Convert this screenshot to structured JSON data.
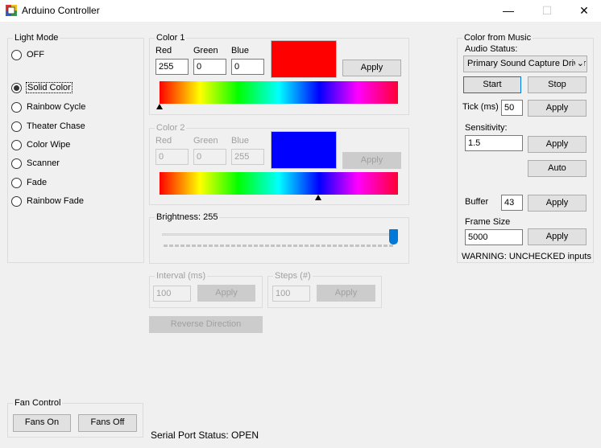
{
  "window": {
    "title": "Arduino Controller"
  },
  "light_mode": {
    "title": "Light Mode",
    "options": [
      {
        "label": "OFF",
        "checked": false
      },
      {
        "label": "Solid Color",
        "checked": true
      },
      {
        "label": "Rainbow Cycle",
        "checked": false
      },
      {
        "label": "Theater Chase",
        "checked": false
      },
      {
        "label": "Color Wipe",
        "checked": false
      },
      {
        "label": "Scanner",
        "checked": false
      },
      {
        "label": "Fade",
        "checked": false
      },
      {
        "label": "Rainbow Fade",
        "checked": false
      }
    ]
  },
  "color1": {
    "title": "Color 1",
    "red_label": "Red",
    "green_label": "Green",
    "blue_label": "Blue",
    "red": "255",
    "green": "0",
    "blue": "0",
    "swatch_color": "#ff0000",
    "apply": "Apply"
  },
  "color2": {
    "title": "Color 2",
    "red_label": "Red",
    "green_label": "Green",
    "blue_label": "Blue",
    "red": "0",
    "green": "0",
    "blue": "255",
    "swatch_color": "#0000ff",
    "apply": "Apply"
  },
  "brightness": {
    "label": "Brightness: 255",
    "value": 255,
    "max": 255
  },
  "interval": {
    "title": "Interval (ms)",
    "value": "100",
    "apply": "Apply"
  },
  "steps": {
    "title": "Steps (#)",
    "value": "100",
    "apply": "Apply"
  },
  "reverse_direction": "Reverse Direction",
  "fan_control": {
    "title": "Fan Control",
    "on": "Fans On",
    "off": "Fans Off"
  },
  "serial_status": "Serial Port Status: OPEN",
  "music": {
    "title": "Color from Music",
    "audio_status_label": "Audio Status:",
    "audio_device": "Primary Sound Capture Driver",
    "start": "Start",
    "stop": "Stop",
    "tick_label": "Tick (ms)",
    "tick_value": "50",
    "tick_apply": "Apply",
    "sensitivity_label": "Sensitivity:",
    "sensitivity_value": "1.5",
    "sensitivity_apply": "Apply",
    "auto": "Auto",
    "buffer_label": "Buffer",
    "buffer_value": "43",
    "buffer_apply": "Apply",
    "frame_size_label": "Frame Size",
    "frame_size_value": "5000",
    "frame_size_apply": "Apply",
    "warning": "WARNING: UNCHECKED inputs"
  }
}
